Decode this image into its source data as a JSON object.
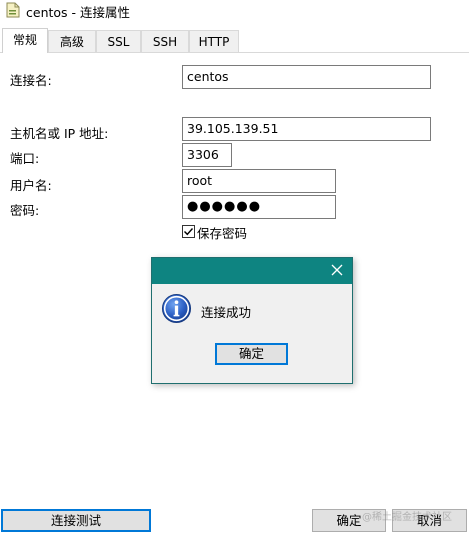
{
  "window": {
    "title": "centos - 连接属性"
  },
  "tabs": [
    {
      "label": "常规",
      "active": true
    },
    {
      "label": "高级",
      "active": false
    },
    {
      "label": "SSL",
      "active": false
    },
    {
      "label": "SSH",
      "active": false
    },
    {
      "label": "HTTP",
      "active": false
    }
  ],
  "form": {
    "connection_name_label": "连接名:",
    "connection_name_value": "centos",
    "host_label": "主机名或 IP 地址:",
    "host_value": "39.105.139.51",
    "port_label": "端口:",
    "port_value": "3306",
    "username_label": "用户名:",
    "username_value": "root",
    "password_label": "密码:",
    "password_value": "●●●●●●",
    "save_password_label": "保存密码",
    "save_password_checked": true
  },
  "dialog": {
    "message": "连接成功",
    "ok_label": "确定",
    "title_bar_color": "#0e8481"
  },
  "footer": {
    "test_connection_label": "连接测试",
    "ok_label": "确定",
    "cancel_label": "取消",
    "watermark": "@稀土掘金技术社区"
  },
  "colors": {
    "accent": "#0078d7"
  }
}
